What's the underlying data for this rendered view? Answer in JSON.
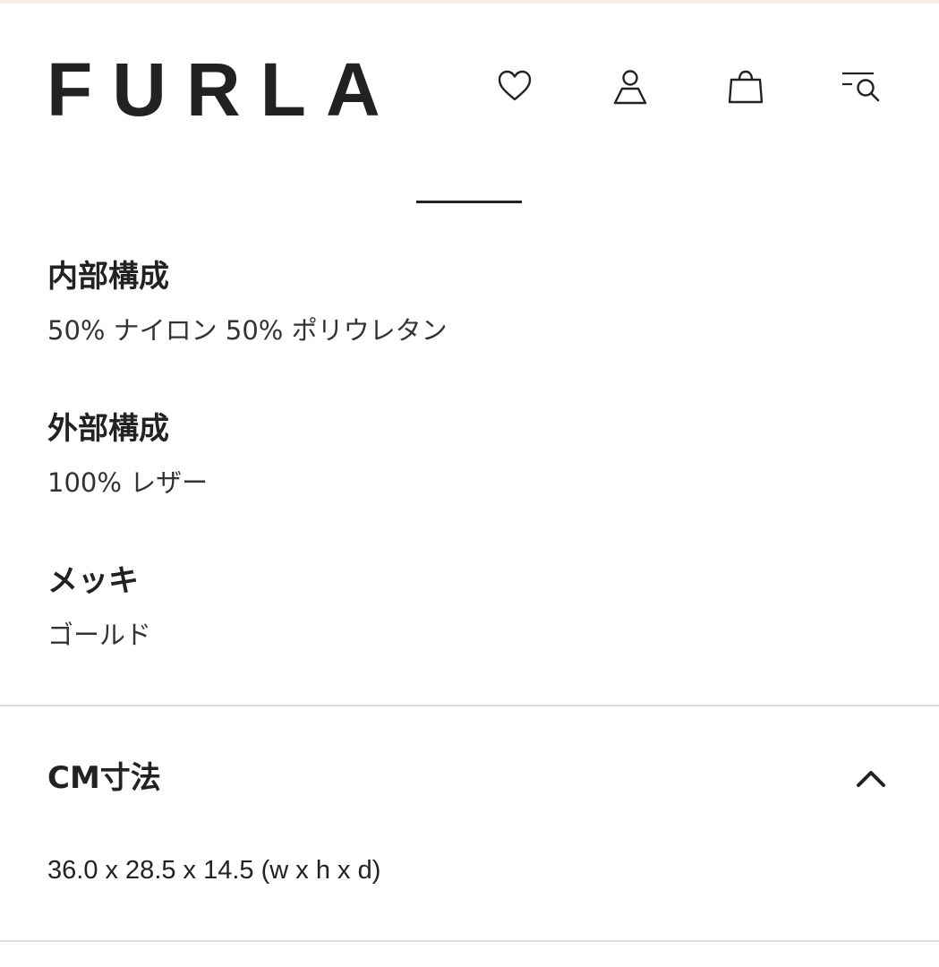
{
  "header": {
    "logo": "FURLA",
    "icons": [
      "heart-icon",
      "user-icon",
      "shopping-bag-icon",
      "menu-search-icon"
    ]
  },
  "details": [
    {
      "title": "内部構成",
      "value": "50% ナイロン 50% ポリウレタン"
    },
    {
      "title": "外部構成",
      "value": "100% レザー"
    },
    {
      "title": "メッキ",
      "value": "ゴールド"
    }
  ],
  "dimensions": {
    "title": "CM寸法",
    "value": "36.0 x 28.5 x 14.5 (w x h x d)",
    "expanded": true
  },
  "colors": {
    "text": "#222222",
    "divider": "#dddddd",
    "top_strip": "#f3efe6"
  }
}
